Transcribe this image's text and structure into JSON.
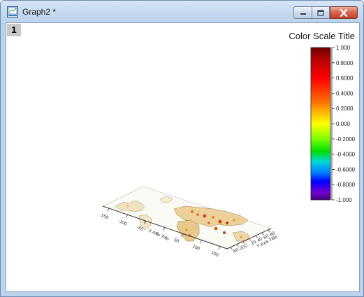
{
  "window": {
    "title": "Graph2 *",
    "layer_label": "1"
  },
  "color_scale": {
    "title": "Color Scale Title",
    "ticks": [
      "1.000",
      "0.8000",
      "0.6000",
      "0.4000",
      "0.2000",
      "0.000",
      "-0.2000",
      "-0.4000",
      "-0.6000",
      "-0.8000",
      "-1.000"
    ],
    "colors_top_to_bottom": [
      "#6b0000",
      "#b80000",
      "#ff0000",
      "#ff6a00",
      "#ffb000",
      "#ffff00",
      "#7dff00",
      "#00e000",
      "#00d8d8",
      "#0080ff",
      "#0000ff",
      "#7000d0",
      "#4a0080"
    ]
  },
  "plot3d": {
    "x_axis_title": "X Axis Title",
    "y_axis_title": "Y Axis Title",
    "x_ticks": [
      "-150",
      "-100",
      "-50",
      "0",
      "50",
      "100",
      "150"
    ],
    "y_ticks": [
      "-50",
      "-20",
      "0",
      "20",
      "40",
      "60",
      "80"
    ]
  }
}
